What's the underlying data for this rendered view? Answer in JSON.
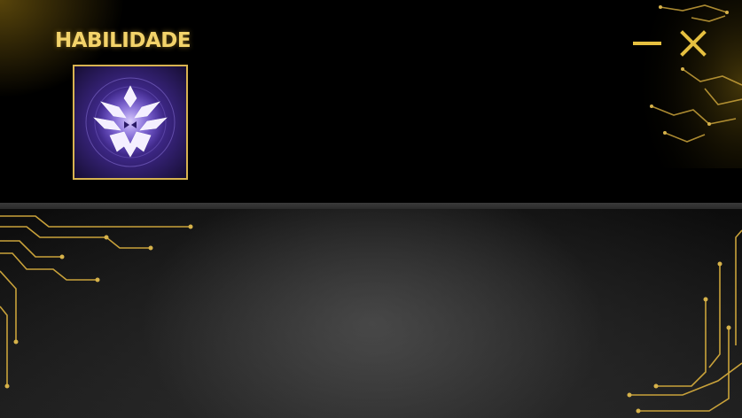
{
  "window": {
    "title": "HABILIDADE"
  },
  "controls": {
    "minimize_icon": "minimize-icon",
    "close_icon": "close-icon"
  },
  "skill": {
    "icon": "purple-demon-mask-emblem-icon"
  },
  "colors": {
    "accent_gold": "#f3d36a",
    "frame_gold": "#d8b350",
    "background": "#000000",
    "skill_purple": "#6a4bd0"
  }
}
